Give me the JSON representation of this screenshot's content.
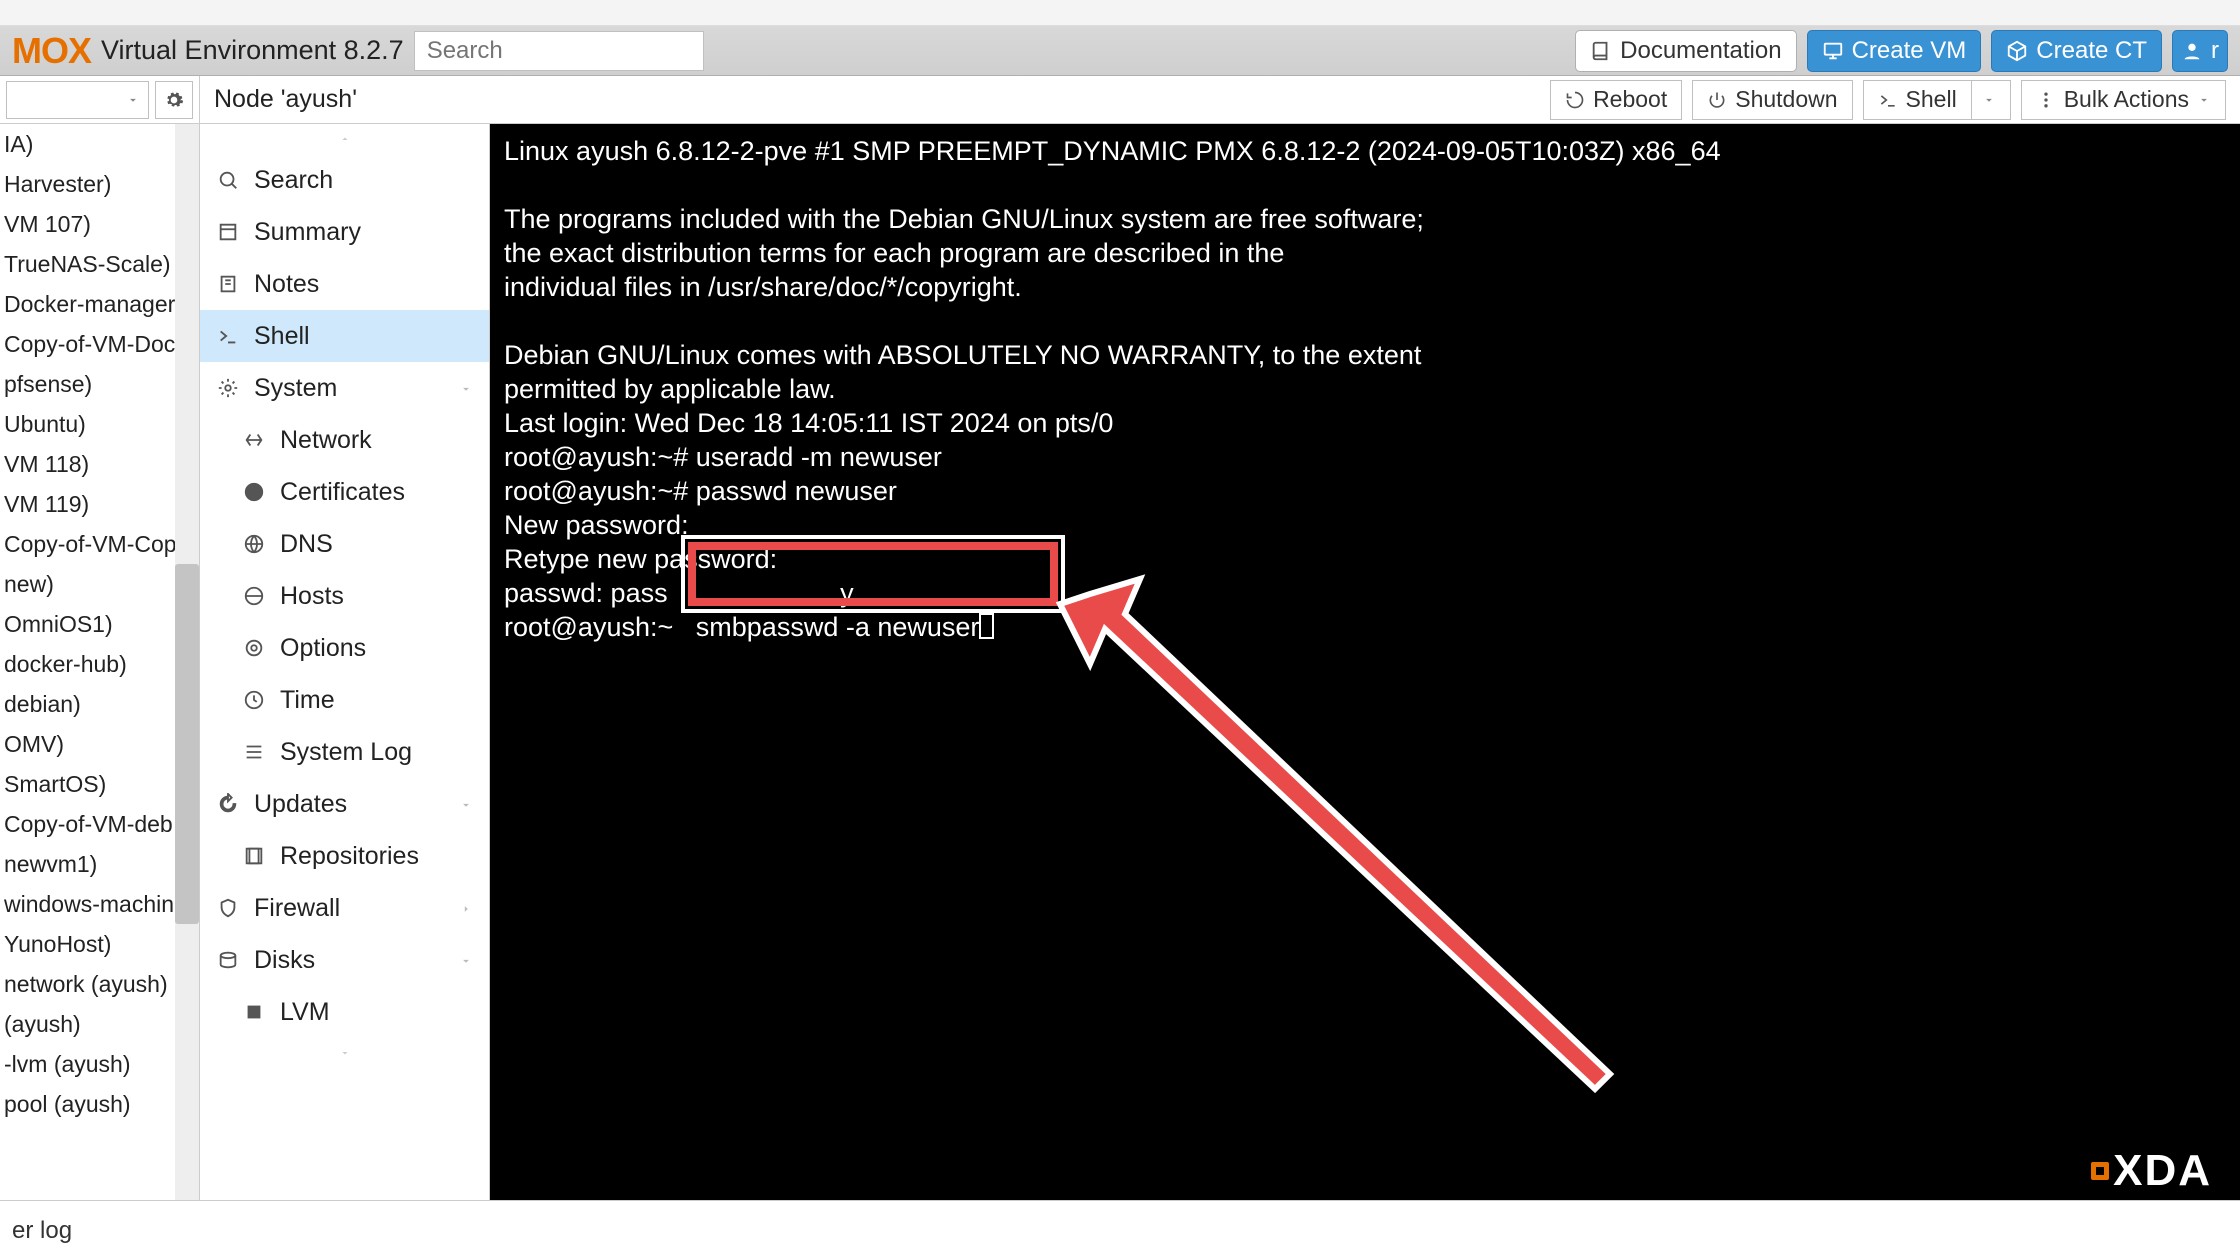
{
  "header": {
    "logo": "MOX",
    "product": "Virtual Environment 8.2.7",
    "search_placeholder": "Search",
    "documentation": "Documentation",
    "create_vm": "Create VM",
    "create_ct": "Create CT"
  },
  "node_bar": {
    "title": "Node 'ayush'",
    "reboot": "Reboot",
    "shutdown": "Shutdown",
    "shell": "Shell",
    "bulk": "Bulk Actions"
  },
  "tree": [
    "IA)",
    "Harvester)",
    "VM 107)",
    "TrueNAS-Scale)",
    "Docker-manager",
    "Copy-of-VM-Doc",
    "pfsense)",
    "Ubuntu)",
    "VM 118)",
    "VM 119)",
    "Copy-of-VM-Cop",
    "new)",
    "OmniOS1)",
    "docker-hub)",
    "debian)",
    "OMV)",
    "SmartOS)",
    "Copy-of-VM-deb",
    "newvm1)",
    "windows-machin",
    "YunoHost)",
    "network (ayush)",
    " (ayush)",
    "-lvm (ayush)",
    "pool (ayush)"
  ],
  "sidenav": [
    {
      "icon": "search",
      "label": "Search"
    },
    {
      "icon": "summary",
      "label": "Summary"
    },
    {
      "icon": "notes",
      "label": "Notes"
    },
    {
      "icon": "shell",
      "label": "Shell",
      "selected": true
    },
    {
      "icon": "system",
      "label": "System",
      "expand": true
    },
    {
      "icon": "network",
      "label": "Network",
      "sub": true
    },
    {
      "icon": "cert",
      "label": "Certificates",
      "sub": true
    },
    {
      "icon": "dns",
      "label": "DNS",
      "sub": true
    },
    {
      "icon": "hosts",
      "label": "Hosts",
      "sub": true
    },
    {
      "icon": "options",
      "label": "Options",
      "sub": true
    },
    {
      "icon": "time",
      "label": "Time",
      "sub": true
    },
    {
      "icon": "syslog",
      "label": "System Log",
      "sub": true
    },
    {
      "icon": "updates",
      "label": "Updates",
      "expand": true
    },
    {
      "icon": "repos",
      "label": "Repositories",
      "sub": true
    },
    {
      "icon": "firewall",
      "label": "Firewall",
      "chev": true
    },
    {
      "icon": "disks",
      "label": "Disks",
      "expand": true
    },
    {
      "icon": "lvm",
      "label": "LVM",
      "sub": true
    }
  ],
  "terminal": {
    "l1": "Linux ayush 6.8.12-2-pve #1 SMP PREEMPT_DYNAMIC PMX 6.8.12-2 (2024-09-05T10:03Z) x86_64",
    "l2": "",
    "l3": "The programs included with the Debian GNU/Linux system are free software;",
    "l4": "the exact distribution terms for each program are described in the",
    "l5": "individual files in /usr/share/doc/*/copyright.",
    "l6": "",
    "l7": "Debian GNU/Linux comes with ABSOLUTELY NO WARRANTY, to the extent",
    "l8": "permitted by applicable law.",
    "l9": "Last login: Wed Dec 18 14:05:11 IST 2024 on pts/0",
    "l10": "root@ayush:~# useradd -m newuser",
    "l11": "root@ayush:~# passwd newuser",
    "l12": "New password:",
    "l13": "Retype new password:",
    "l14": "passwd: pass",
    "l14b": "y",
    "l15a": "root@ayush:~",
    "l15b": "smbpasswd -a newuser"
  },
  "bottom": {
    "label": "er log"
  },
  "watermark": "XDA"
}
